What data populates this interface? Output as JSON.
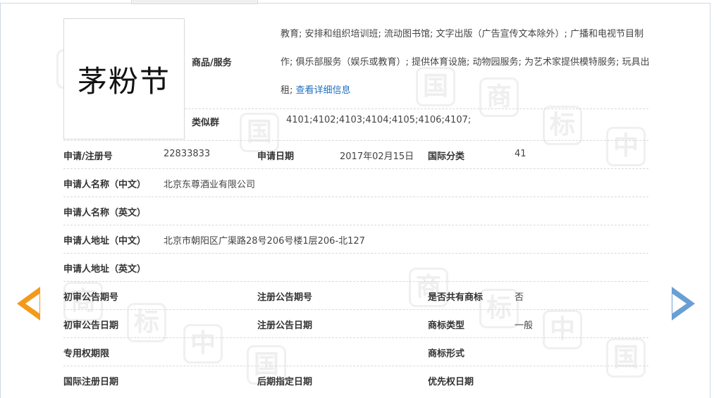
{
  "logo": {
    "text": "茅粉节"
  },
  "goods": {
    "label": "商品/服务",
    "text": "教育; 安排和组织培训班; 流动图书馆; 文字出版（广告宣传文本除外）; 广播和电视节目制作; 俱乐部服务（娱乐或教育）; 提供体育设施; 动物园服务; 为艺术家提供模特服务; 玩具出租; ",
    "link": "查看详细信息"
  },
  "similar_groups": {
    "label": "类似群",
    "value": "4101;4102;4103;4104;4105;4106;4107;"
  },
  "registration": {
    "reg_no_label": "申请/注册号",
    "reg_no": "22833833",
    "app_date_label": "申请日期",
    "app_date": "2017年02月15日",
    "intl_class_label": "国际分类",
    "intl_class": "41"
  },
  "applicant": {
    "name_cn_label": "申请人名称（中文）",
    "name_cn": "北京东尊酒业有限公司",
    "name_en_label": "申请人名称（英文）",
    "name_en": "",
    "addr_cn_label": "申请人地址（中文）",
    "addr_cn": "北京市朝阳区广渠路28号206号楼1层206-北127",
    "addr_en_label": "申请人地址（英文）",
    "addr_en": ""
  },
  "announce": {
    "prelim_no_label": "初审公告期号",
    "prelim_no": "",
    "reg_no_label": "注册公告期号",
    "reg_no": "",
    "shared_label": "是否共有商标",
    "shared": "否",
    "prelim_date_label": "初审公告日期",
    "prelim_date": "",
    "reg_date_label": "注册公告日期",
    "reg_date": "",
    "type_label": "商标类型",
    "type": "一般"
  },
  "rights": {
    "period_label": "专用权期限",
    "period": "",
    "form_label": "商标形式",
    "form": "",
    "intl_reg_label": "国际注册日期",
    "intl_reg": "",
    "later_label": "后期指定日期",
    "later": "",
    "priority_label": "优先权日期",
    "priority": ""
  },
  "watermark": {
    "text": "中国商标"
  },
  "colors": {
    "accent_orange": "#f39a1a",
    "accent_blue": "#6a9fd3",
    "link": "#1f6fbf"
  }
}
